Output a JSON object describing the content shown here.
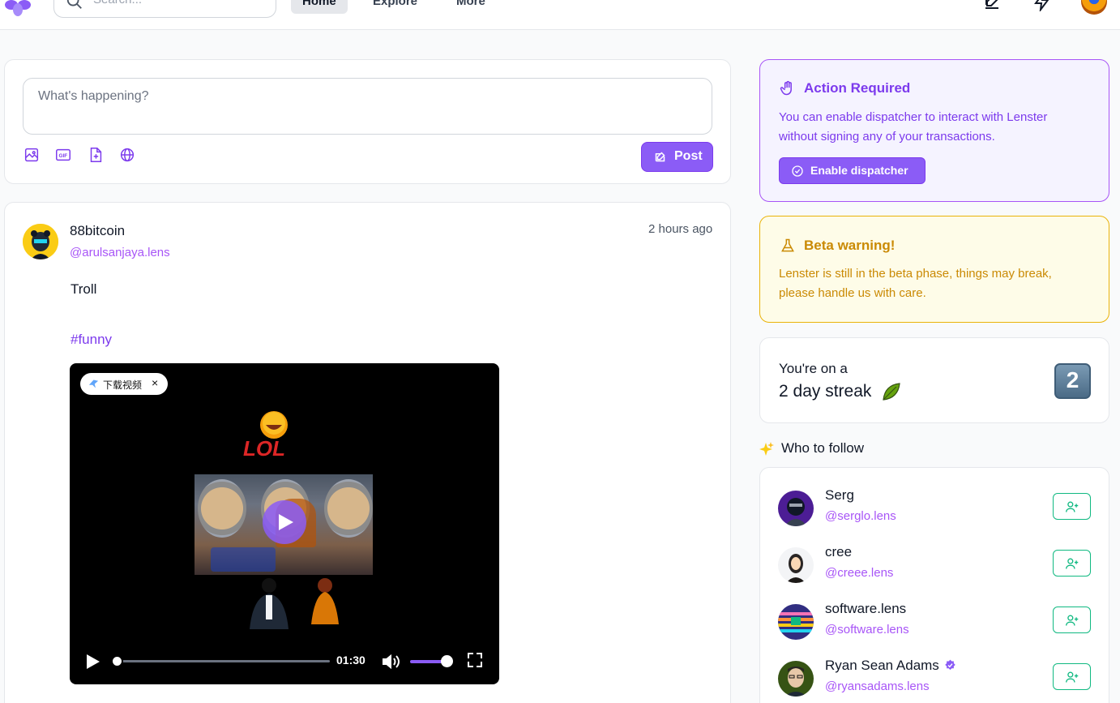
{
  "nav": {
    "search_placeholder": "Search...",
    "items": [
      "Home",
      "Explore",
      "More"
    ]
  },
  "composer": {
    "placeholder": "What's happening?",
    "post_label": "Post",
    "tools": [
      "image-icon",
      "gif-icon",
      "attachment-icon",
      "globe-icon"
    ]
  },
  "post": {
    "author_name": "88bitcoin",
    "author_handle": "@arulsanjaya.lens",
    "time": "2 hours ago",
    "body": "Troll",
    "hashtag": "#funny",
    "video": {
      "download_pill": "下载视频",
      "close": "×",
      "time": "01:30",
      "progress": 0.0,
      "volume": 0.85
    }
  },
  "action_required": {
    "title": "Action Required",
    "description": "You can enable dispatcher to interact with Lenster without signing any of your transactions.",
    "button": "Enable dispatcher"
  },
  "beta": {
    "title": "Beta warning!",
    "description": "Lenster is still in the beta phase, things may break, please handle us with care."
  },
  "streak": {
    "line1": "You're on a",
    "line2": "2 day streak",
    "badge": "2"
  },
  "who_to_follow": {
    "title": "Who to follow",
    "people": [
      {
        "name": "Serg",
        "handle": "@serglo.lens",
        "verified": false
      },
      {
        "name": "cree",
        "handle": "@creee.lens",
        "verified": false
      },
      {
        "name": "software.lens",
        "handle": "@software.lens",
        "verified": false
      },
      {
        "name": "Ryan Sean Adams",
        "handle": "@ryansadams.lens",
        "verified": true
      }
    ]
  },
  "colors": {
    "brand": "#8b5cf6",
    "handle": "#a855f7",
    "warning": "#ca8a04",
    "follow": "#10b981"
  }
}
